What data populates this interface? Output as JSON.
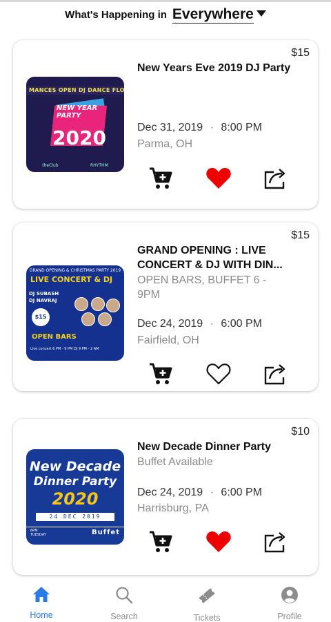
{
  "header": {
    "prefix": "What's Happening in",
    "location": "Everywhere"
  },
  "events": [
    {
      "price": "$15",
      "title": "New Years Eve 2019 DJ Party",
      "subtitle": "",
      "date": "Dec 31, 2019",
      "separator": "·",
      "time": "8:00 PM",
      "city": "Parma, OH",
      "favorited": true,
      "image": {
        "banner": "MANCES   OPEN DJ DANCE FLOOR   OP",
        "line1": "NEW YEAR PARTY",
        "year": "2020",
        "footer_left": "theClub",
        "footer_right": "RHYTHM"
      }
    },
    {
      "price": "$15",
      "title": "GRAND OPENING :  LIVE CONCERT & DJ  WITH DIN...",
      "subtitle": "OPEN BARS, BUFFET 6 - 9PM",
      "date": "Dec 24, 2019",
      "separator": "·",
      "time": "6:00 PM",
      "city": "Fairfield, OH",
      "favorited": false,
      "image": {
        "top": "GRAND OPENING & CHRISTMAS PARTY 2019",
        "headline": "LIVE CONCERT & DJ",
        "dj1": "DJ SUBASH",
        "dj2": "DJ NAVRAJ",
        "badge": "$15",
        "bars": "OPEN BARS",
        "fine": "Live concert 6 PM - 9 PM  DJ 9 PM - 2 AM"
      }
    },
    {
      "price": "$10",
      "title": "New Decade Dinner Party",
      "subtitle": "Buffet Available",
      "date": "Dec 24, 2019",
      "separator": "·",
      "time": "6:00 PM",
      "city": "Harrisburg, PA",
      "favorited": true,
      "image": {
        "line1": "New Decade",
        "line2": "Dinner Party",
        "year": "2020",
        "datebox": "24 DEC 2019",
        "strip_left": "6PM\nTUESDAY",
        "strip_right": "Buffet"
      }
    }
  ],
  "nav": {
    "tabs": [
      {
        "label": "Home",
        "icon": "home-icon",
        "active": true
      },
      {
        "label": "Search",
        "icon": "search-icon",
        "active": false
      },
      {
        "label": "Tickets",
        "icon": "ticket-icon",
        "active": false
      },
      {
        "label": "Profile",
        "icon": "profile-icon",
        "active": false
      }
    ]
  },
  "colors": {
    "accent": "#2b7be4",
    "heart": "#ee0000",
    "muted_text": "#8a8a8a",
    "inactive_tab": "#8c8c8c"
  }
}
